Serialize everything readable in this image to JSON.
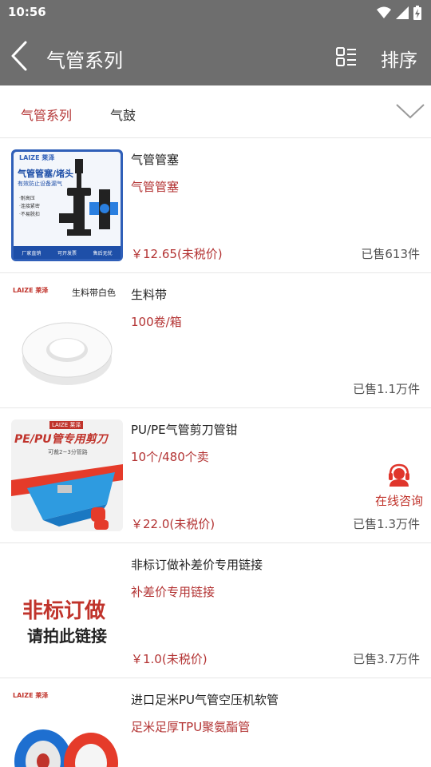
{
  "status_bar": {
    "time": "10:56"
  },
  "header": {
    "title": "气管系列",
    "sort_label": "排序"
  },
  "tabs": [
    {
      "label": "气管系列",
      "active": true
    },
    {
      "label": "气鼓",
      "active": false
    }
  ],
  "products": [
    {
      "name": "气管管塞",
      "subtitle": "气管管塞",
      "price": "￥12.65(未税价)",
      "sold": "已售613件",
      "image": {
        "brand": "LAIZE 莱泽",
        "headline": "气管管塞/堵头",
        "tagline": "有效防止设备漏气",
        "features": [
          "·耐高压",
          "·连接紧密",
          "·不易脱扣"
        ],
        "badges": [
          "厂家直销",
          "可开发票",
          "售后无忧"
        ]
      }
    },
    {
      "name": "生料带",
      "subtitle": "100卷/箱",
      "price": "",
      "sold": "已售1.1万件",
      "image": {
        "brand": "LAIZE 莱泽",
        "caption": "生料带白色"
      }
    },
    {
      "name": "PU/PE气管剪刀管钳",
      "subtitle": "10个/480个卖",
      "price": "￥22.0(未税价)",
      "sold": "已售1.3万件",
      "image": {
        "brand": "LAIZE 莱泽",
        "headline": "PE/PU管专用剪刀",
        "tagline": "可裁2~3分管路"
      }
    },
    {
      "name": "非标订做补差价专用链接",
      "subtitle": "补差价专用链接",
      "price": "￥1.0(未税价)",
      "sold": "已售3.7万件",
      "image": {
        "line1": "非标订做",
        "line2": "请拍此链接"
      }
    },
    {
      "name": "进口足米PU气管空压机软管",
      "subtitle": "足米足厚TPU聚氨酯管",
      "price": "",
      "sold": "",
      "image": {
        "brand": "LAIZE 莱泽"
      }
    }
  ],
  "consult": {
    "label": "在线咨询"
  },
  "colors": {
    "accent": "#b33333",
    "bar": "#6e6e6e"
  }
}
